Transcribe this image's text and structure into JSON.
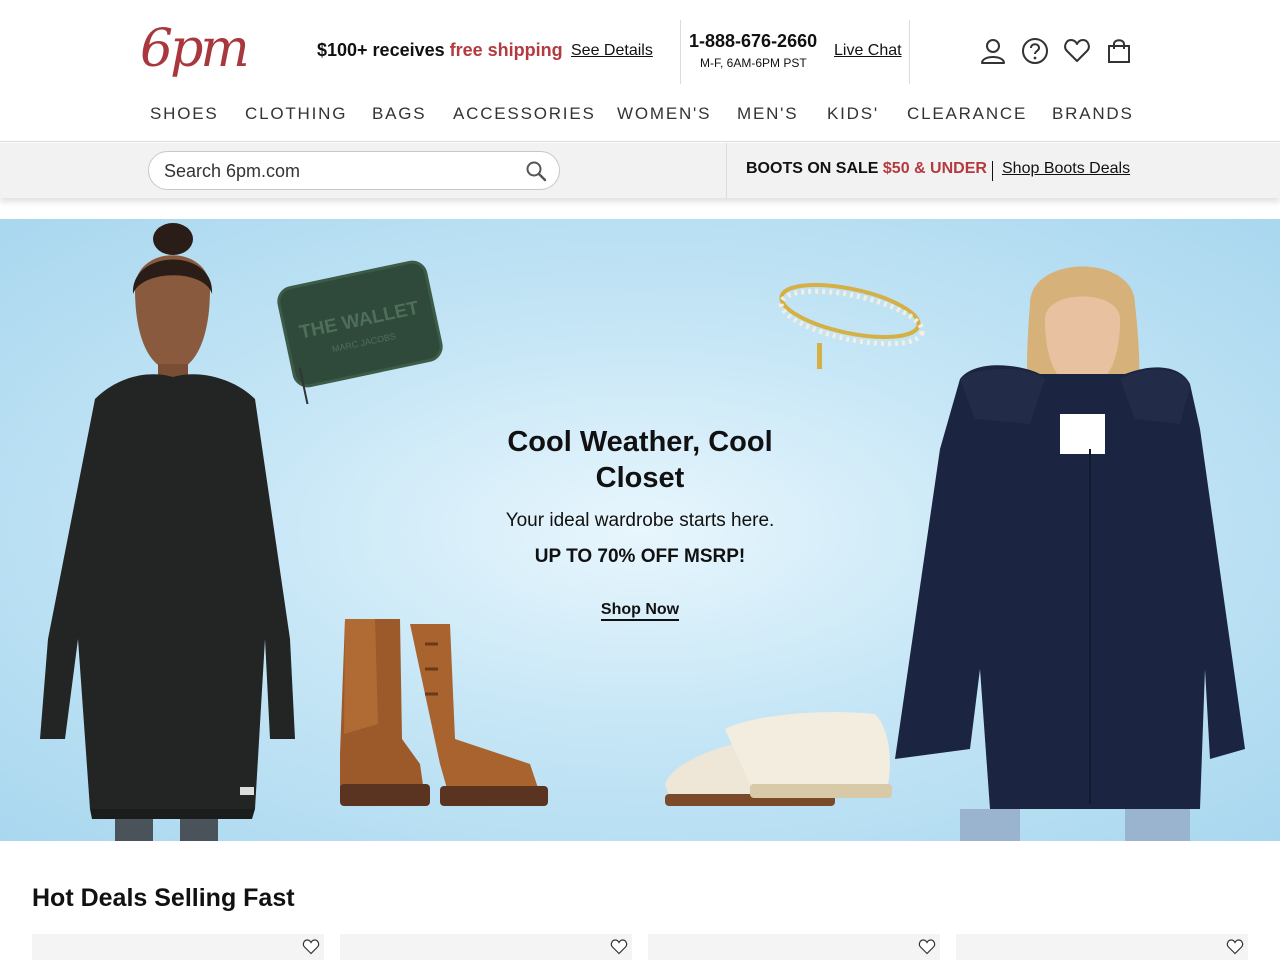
{
  "header": {
    "logo_text": "6pm",
    "promo": {
      "prefix": "$100+ receives ",
      "highlight": "free shipping",
      "link": "See Details"
    },
    "phone": "1-888-676-2660",
    "hours": "M-F, 6AM-6PM PST",
    "live_chat": "Live Chat",
    "icons": [
      "account-icon",
      "help-icon",
      "favorites-icon",
      "cart-icon"
    ],
    "accent_color": "#b43a3f"
  },
  "nav": {
    "items": [
      "SHOES",
      "CLOTHING",
      "BAGS",
      "ACCESSORIES",
      "WOMEN'S",
      "MEN'S",
      "KIDS'",
      "CLEARANCE",
      "BRANDS"
    ]
  },
  "search": {
    "placeholder": "Search 6pm.com"
  },
  "boots_banner": {
    "text": "BOOTS ON SALE ",
    "highlight": "$50 & UNDER",
    "link": "Shop Boots Deals"
  },
  "hero": {
    "title": "Cool Weather, Cool Closet",
    "subtitle": "Your ideal wardrobe starts here.",
    "offer": "UP TO 70% OFF MSRP!",
    "cta": "Shop Now",
    "wallet_text": "THE WALLET",
    "wallet_brand": "MARC JACOBS"
  },
  "hot_deals": {
    "title": "Hot Deals Selling Fast",
    "card_count": 4
  }
}
